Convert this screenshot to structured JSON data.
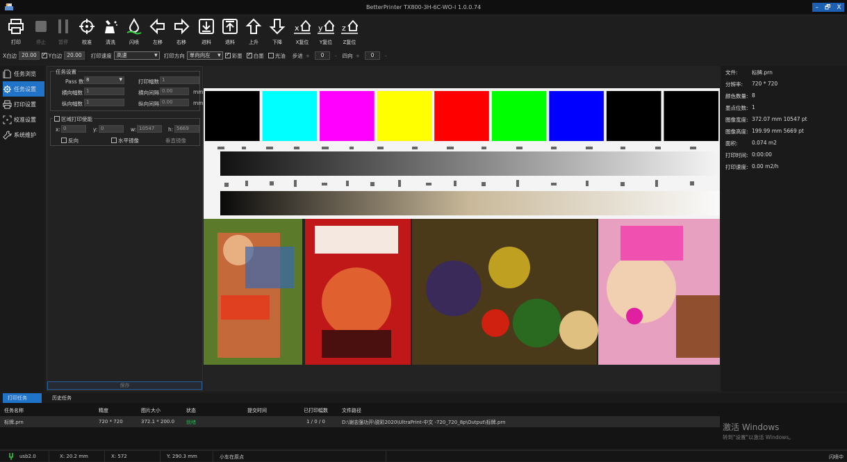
{
  "app": {
    "title": "BetterPrinter TX800-3H-6C-WO-I 1.0.0.74"
  },
  "window_controls": [
    "–",
    "🗗",
    "X"
  ],
  "toolbar": [
    {
      "id": "print",
      "label": "打印",
      "icon": "printer-icon",
      "enabled": true
    },
    {
      "id": "stop",
      "label": "停止",
      "icon": "stop-icon",
      "enabled": false
    },
    {
      "id": "pause",
      "label": "暂停",
      "icon": "pause-icon",
      "enabled": false
    },
    {
      "id": "calibrate",
      "label": "校准",
      "icon": "crosshair-icon",
      "enabled": true
    },
    {
      "id": "clean",
      "label": "清洗",
      "icon": "clean-icon",
      "enabled": true
    },
    {
      "id": "flash",
      "label": "闪喷",
      "icon": "ink-drop-icon",
      "enabled": true
    },
    {
      "id": "left",
      "label": "左移",
      "icon": "arrow-left-icon",
      "enabled": true
    },
    {
      "id": "right",
      "label": "右移",
      "icon": "arrow-right-icon",
      "enabled": true
    },
    {
      "id": "feed-in",
      "label": "进料",
      "icon": "feed-in-icon",
      "enabled": true
    },
    {
      "id": "feed-out",
      "label": "退料",
      "icon": "feed-out-icon",
      "enabled": true
    },
    {
      "id": "up",
      "label": "上升",
      "icon": "arrow-up-icon",
      "enabled": true
    },
    {
      "id": "down",
      "label": "下降",
      "icon": "arrow-down-icon",
      "enabled": true
    },
    {
      "id": "x-reset",
      "label": "X复位",
      "icon": "x-home-icon",
      "enabled": true
    },
    {
      "id": "y-reset",
      "label": "Y复位",
      "icon": "y-home-icon",
      "enabled": true
    },
    {
      "id": "z-reset",
      "label": "Z复位",
      "icon": "z-home-icon",
      "enabled": true
    }
  ],
  "params": {
    "x_margin_label": "X白边",
    "x_margin": "20.00",
    "y_margin_label": "Y白边",
    "y_margin": "20.00",
    "speed_label": "打印速度",
    "speed": "高速",
    "direction_label": "打印方向",
    "direction": "单向向左",
    "color_label": "彩墨",
    "white_label": "白墨",
    "gloss_label": "光油",
    "step_label": "步进",
    "step": "0",
    "fourway_label": "四向",
    "fourway": "0",
    "plus": "+",
    "minus": "-"
  },
  "nav": [
    {
      "label": "任务浏览",
      "icon": "document-icon",
      "active": false
    },
    {
      "label": "任务设置",
      "icon": "gear-icon",
      "active": true
    },
    {
      "label": "打印设置",
      "icon": "printer-icon",
      "active": false
    },
    {
      "label": "校准设置",
      "icon": "calibrate-icon",
      "active": false
    },
    {
      "label": "系统维护",
      "icon": "wrench-icon",
      "active": false
    }
  ],
  "task": {
    "group_title": "任务设置",
    "pass_label": "Pass 数",
    "pass": "8",
    "copies_label": "打印幅数",
    "copies": "1",
    "hcount_label": "横向幅数",
    "hcount": "1",
    "hgap_label": "横向间隔",
    "hgap": "0.00",
    "hgap_unit": "mm",
    "vcount_label": "纵向幅数",
    "vcount": "1",
    "vgap_label": "纵向间隔",
    "vgap": "0.00",
    "vgap_unit": "mm",
    "region_label": "区域打印使能",
    "x_label": "x:",
    "x": "0",
    "y_label": "y:",
    "y": "0",
    "w_label": "w:",
    "w": "10547",
    "h_label": "h:",
    "h": "5669",
    "reverse_label": "反向",
    "hmirror_label": "水平镜像",
    "vmirror_label": "垂直镜像",
    "save_label": "保存"
  },
  "info": [
    {
      "k": "文件:",
      "v": "标牌.prn"
    },
    {
      "k": "分辨率:",
      "v": "720 * 720"
    },
    {
      "k": "颜色数量:",
      "v": "8"
    },
    {
      "k": "墨点位数:",
      "v": "1"
    },
    {
      "k": "图像宽度:",
      "v": "372.07 mm   10547 pt"
    },
    {
      "k": "图像高度:",
      "v": "199.99 mm   5669 pt"
    },
    {
      "k": "面积:",
      "v": "0.074 m2"
    },
    {
      "k": "打印时间:",
      "v": "0:00:00"
    },
    {
      "k": "打印速度:",
      "v": "0.00 m2/h"
    }
  ],
  "tabs": [
    {
      "label": "打印任务",
      "active": true
    },
    {
      "label": "历史任务",
      "active": false
    }
  ],
  "table": {
    "headers": [
      "任务名称",
      "精度",
      "图片大小",
      "状态",
      "提交时间",
      "已打印幅数",
      "文件路径"
    ],
    "rows": [
      [
        "标牌.prn",
        "720 * 720",
        "372.1 * 200.0",
        "就绪",
        "",
        "1 / 0 / 0",
        "D:\\谢志强功开\\锐彩2020\\UltraPrint-中文 -720_720_8p\\Output\\标牌.prn"
      ]
    ]
  },
  "activate": {
    "title": "激活 Windows",
    "sub": "转到\"设置\"以激活 Windows。"
  },
  "status": {
    "usb": "usb2.0",
    "x_mm": "X: 20.2 mm",
    "x": "X: 572",
    "y": "Y: 290.3 mm",
    "cart": "小车在原点",
    "right": "闪喷中"
  },
  "colors": {
    "accent": "#1f73c9",
    "status_ready": "#22b14c",
    "flash_green": "#2ecc40"
  },
  "preview_swatches": [
    "#000000",
    "#00ffff",
    "#ff00ff",
    "#ffff00",
    "#ff0000",
    "#00ff00",
    "#0000ff",
    "#000000",
    "#000000"
  ]
}
